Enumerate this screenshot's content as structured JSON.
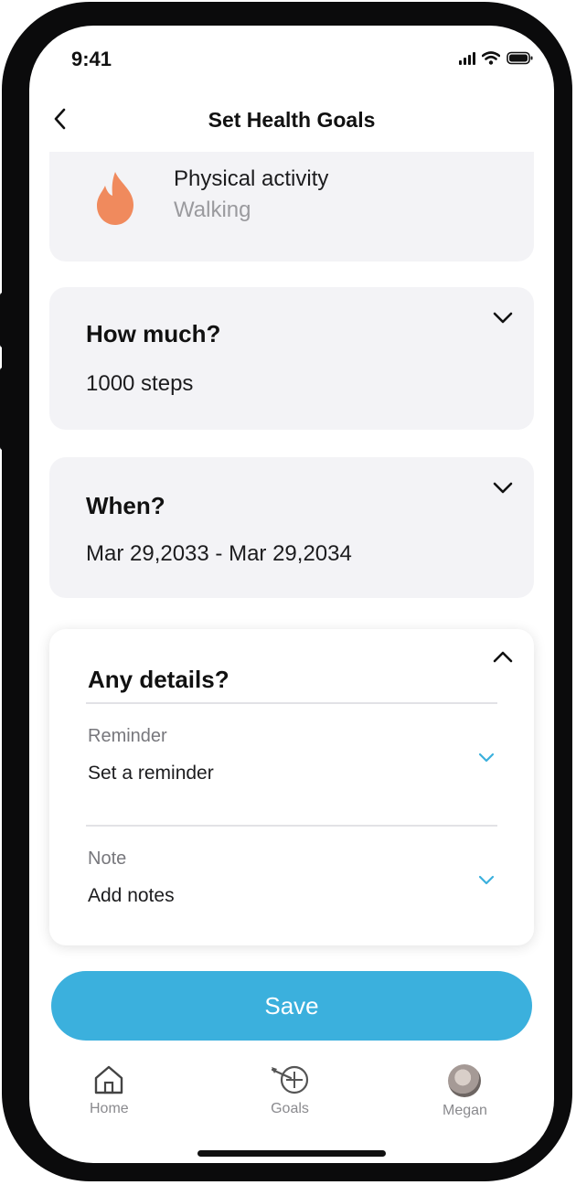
{
  "status_bar": {
    "time": "9:41"
  },
  "nav": {
    "title": "Set Health Goals"
  },
  "activity": {
    "title": "Physical activity",
    "subtitle": "Walking",
    "icon": "flame-icon",
    "icon_color": "#f08a5d"
  },
  "how_much": {
    "title": "How much?",
    "value": "1000 steps"
  },
  "when": {
    "title": "When?",
    "value": "Mar 29,2033 - Mar 29,2034"
  },
  "details": {
    "title": "Any details?",
    "reminder": {
      "label": "Reminder",
      "value": "Set a reminder"
    },
    "note": {
      "label": "Note",
      "value": "Add notes"
    }
  },
  "save_label": "Save",
  "tabs": [
    {
      "label": "Home",
      "icon": "home-icon"
    },
    {
      "label": "Goals",
      "icon": "goals-target-icon"
    },
    {
      "label": "Megan",
      "icon": "avatar"
    }
  ],
  "colors": {
    "accent": "#3bb0dd",
    "card_bg": "#f3f3f6",
    "flame": "#f08a5d"
  }
}
